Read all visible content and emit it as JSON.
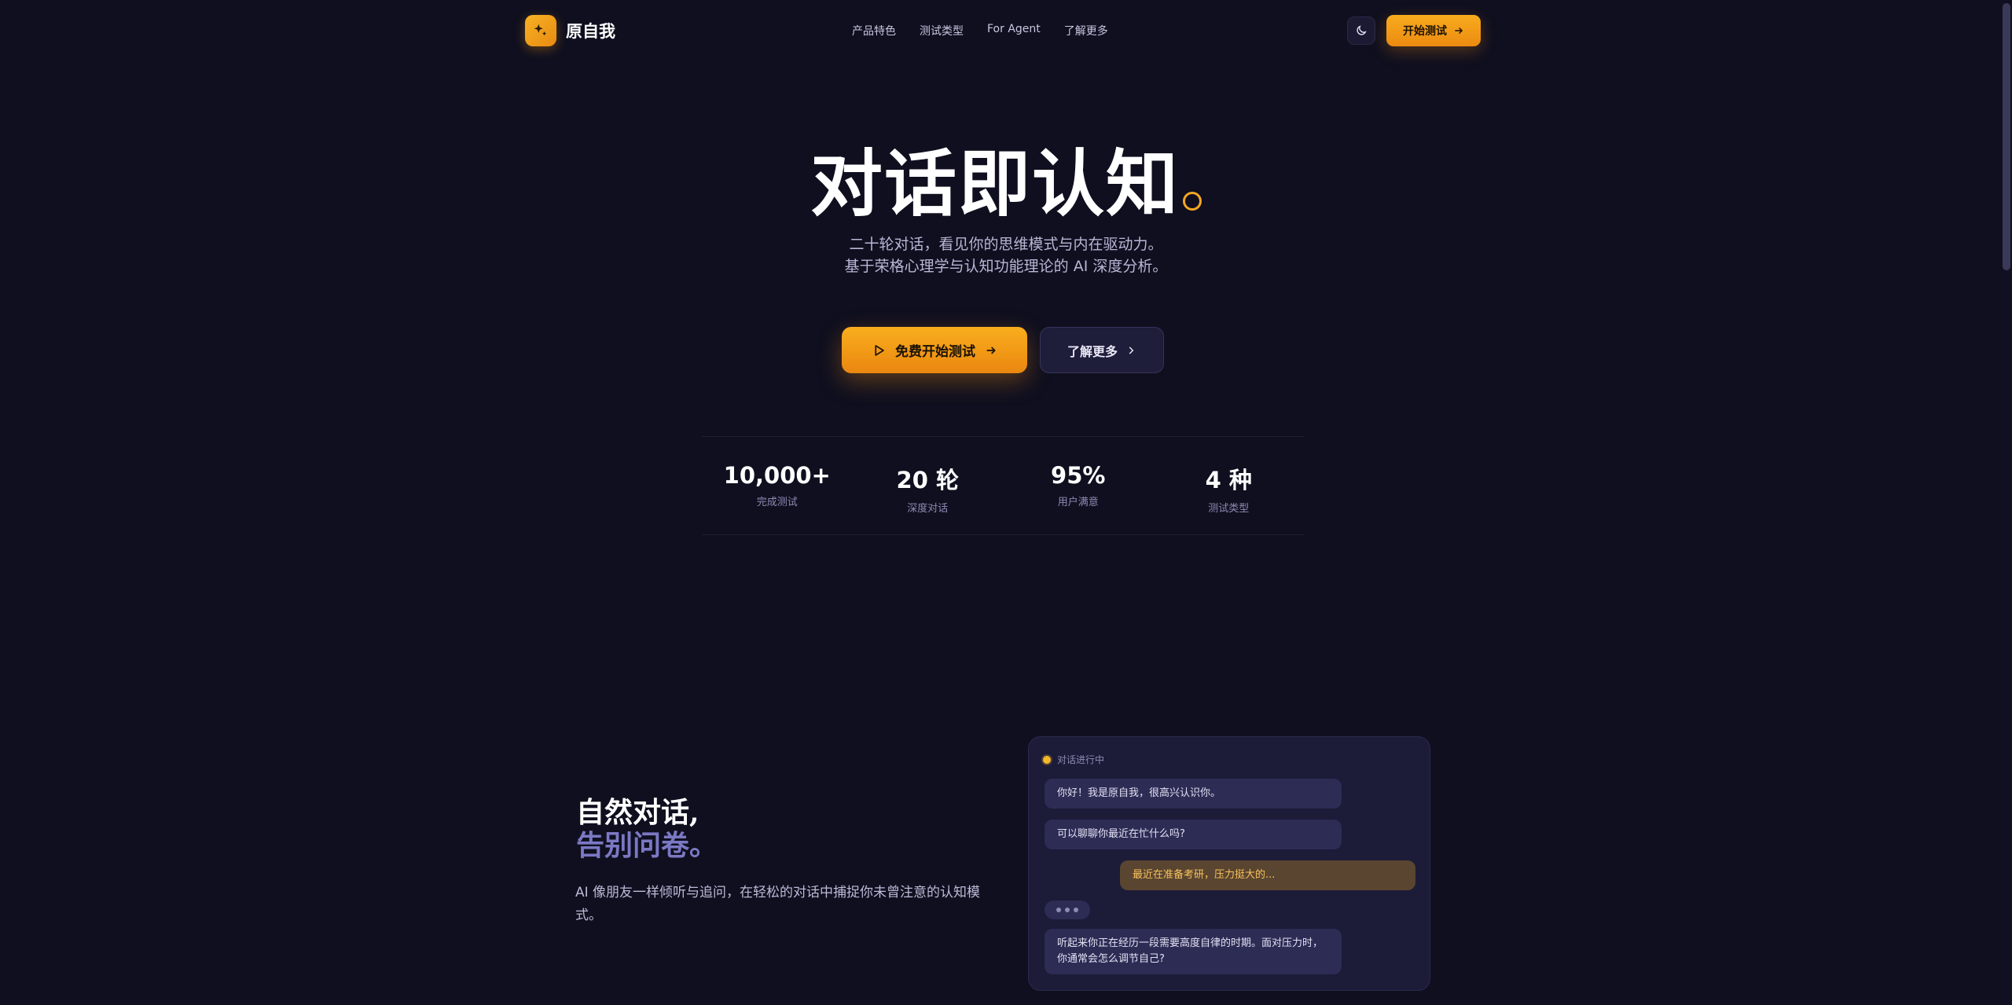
{
  "brand": {
    "name": "原自我"
  },
  "nav": {
    "links": [
      "产品特色",
      "测试类型",
      "For Agent",
      "了解更多"
    ],
    "start_label": "开始测试"
  },
  "hero": {
    "title": "对话即认知",
    "subtitle_line1": "二十轮对话，看见你的思维模式与内在驱动力。",
    "subtitle_line2": "基于荣格心理学与认知功能理论的 AI 深度分析。",
    "primary_cta": "免费开始测试",
    "secondary_cta": "了解更多"
  },
  "stats": [
    {
      "value": "10,000+",
      "label": "完成测试"
    },
    {
      "value": "20 轮",
      "label": "深度对话"
    },
    {
      "value": "95%",
      "label": "用户满意"
    },
    {
      "value": "4 种",
      "label": "测试类型"
    }
  ],
  "feature": {
    "title_line1": "自然对话,",
    "title_line2": "告别问卷。",
    "description": "AI 像朋友一样倾听与追问，在轻松的对话中捕捉你未曾注意的认知模式。"
  },
  "chat": {
    "status": "对话进行中",
    "messages": [
      {
        "role": "ai",
        "text": "你好！我是原自我，很高兴认识你。"
      },
      {
        "role": "ai",
        "text": "可以聊聊你最近在忙什么吗?"
      },
      {
        "role": "user",
        "text": "最近在准备考研，压力挺大的..."
      },
      {
        "role": "ai",
        "text": "听起来你正在经历一段需要高度自律的时期。面对压力时，你通常会怎么调节自己?"
      }
    ]
  },
  "colors": {
    "accent": "#f5a623",
    "background": "#0f0f1f",
    "card": "#1c1b38",
    "muted_purple": "#7b78c4"
  },
  "icons": {
    "logo": "sparkle-icon",
    "theme": "moon-icon",
    "play": "play-icon",
    "arrow": "arrow-right-icon",
    "chevron": "chevron-right-icon"
  }
}
